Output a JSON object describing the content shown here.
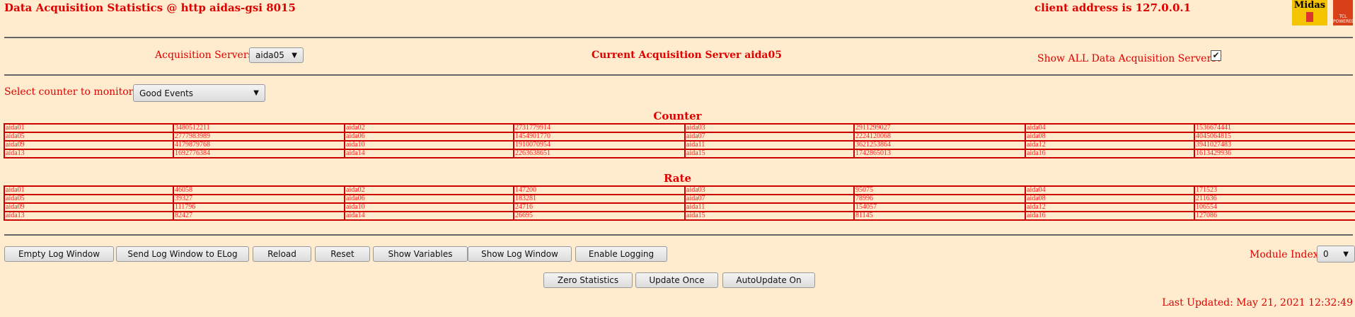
{
  "header": {
    "title": "Data Acquisition Statistics @ http aidas-gsi 8015",
    "client": "client address is 127.0.0.1",
    "logo1": "Midas",
    "logo2": "TCL POWERED"
  },
  "servers": {
    "label": "Acquisition Servers",
    "selected": "aida05",
    "current": "Current Acquisition Server aida05",
    "show_all_label": "Show ALL Data Acquisition Servers?",
    "show_all_checked": true
  },
  "counter_select": {
    "label": "Select counter to monitor",
    "selected": "Good Events"
  },
  "counter": {
    "title": "Counter",
    "rows": [
      [
        [
          "aida01",
          "3480512211"
        ],
        [
          "aida02",
          "2731779914"
        ],
        [
          "aida03",
          "2911299027"
        ],
        [
          "aida04",
          "1536674441"
        ]
      ],
      [
        [
          "aida05",
          "2777983989"
        ],
        [
          "aida06",
          "1454901770"
        ],
        [
          "aida07",
          "2224120068"
        ],
        [
          "aida08",
          "4045064815"
        ]
      ],
      [
        [
          "aida09",
          "4179879768"
        ],
        [
          "aida10",
          "1910070954"
        ],
        [
          "aida11",
          "3621253864"
        ],
        [
          "aida12",
          "3941027483"
        ]
      ],
      [
        [
          "aida13",
          "1692776384"
        ],
        [
          "aida14",
          "2263638651"
        ],
        [
          "aida15",
          "1742865013"
        ],
        [
          "aida16",
          "1613429936"
        ]
      ]
    ]
  },
  "rate": {
    "title": "Rate",
    "rows": [
      [
        [
          "aida01",
          "46058"
        ],
        [
          "aida02",
          "147200"
        ],
        [
          "aida03",
          "95075"
        ],
        [
          "aida04",
          "171523"
        ]
      ],
      [
        [
          "aida05",
          "39327"
        ],
        [
          "aida06",
          "183281"
        ],
        [
          "aida07",
          "78996"
        ],
        [
          "aida08",
          "211636"
        ]
      ],
      [
        [
          "aida09",
          "111796"
        ],
        [
          "aida10",
          "24716"
        ],
        [
          "aida11",
          "154057"
        ],
        [
          "aida12",
          "106554"
        ]
      ],
      [
        [
          "aida13",
          "82427"
        ],
        [
          "aida14",
          "26695"
        ],
        [
          "aida15",
          "81145"
        ],
        [
          "aida16",
          "127086"
        ]
      ]
    ]
  },
  "buttons": {
    "empty_log": "Empty Log Window",
    "send_elog": "Send Log Window to ELog",
    "reload": "Reload",
    "reset": "Reset",
    "show_vars": "Show Variables",
    "show_log": "Show Log Window",
    "enable_logging": "Enable Logging",
    "zero": "Zero Statistics",
    "update_once": "Update Once",
    "autoupdate": "AutoUpdate On"
  },
  "module": {
    "label": "Module Index",
    "selected": "0"
  },
  "footer": {
    "last_updated": "Last Updated: May 21, 2021 12:32:49"
  }
}
